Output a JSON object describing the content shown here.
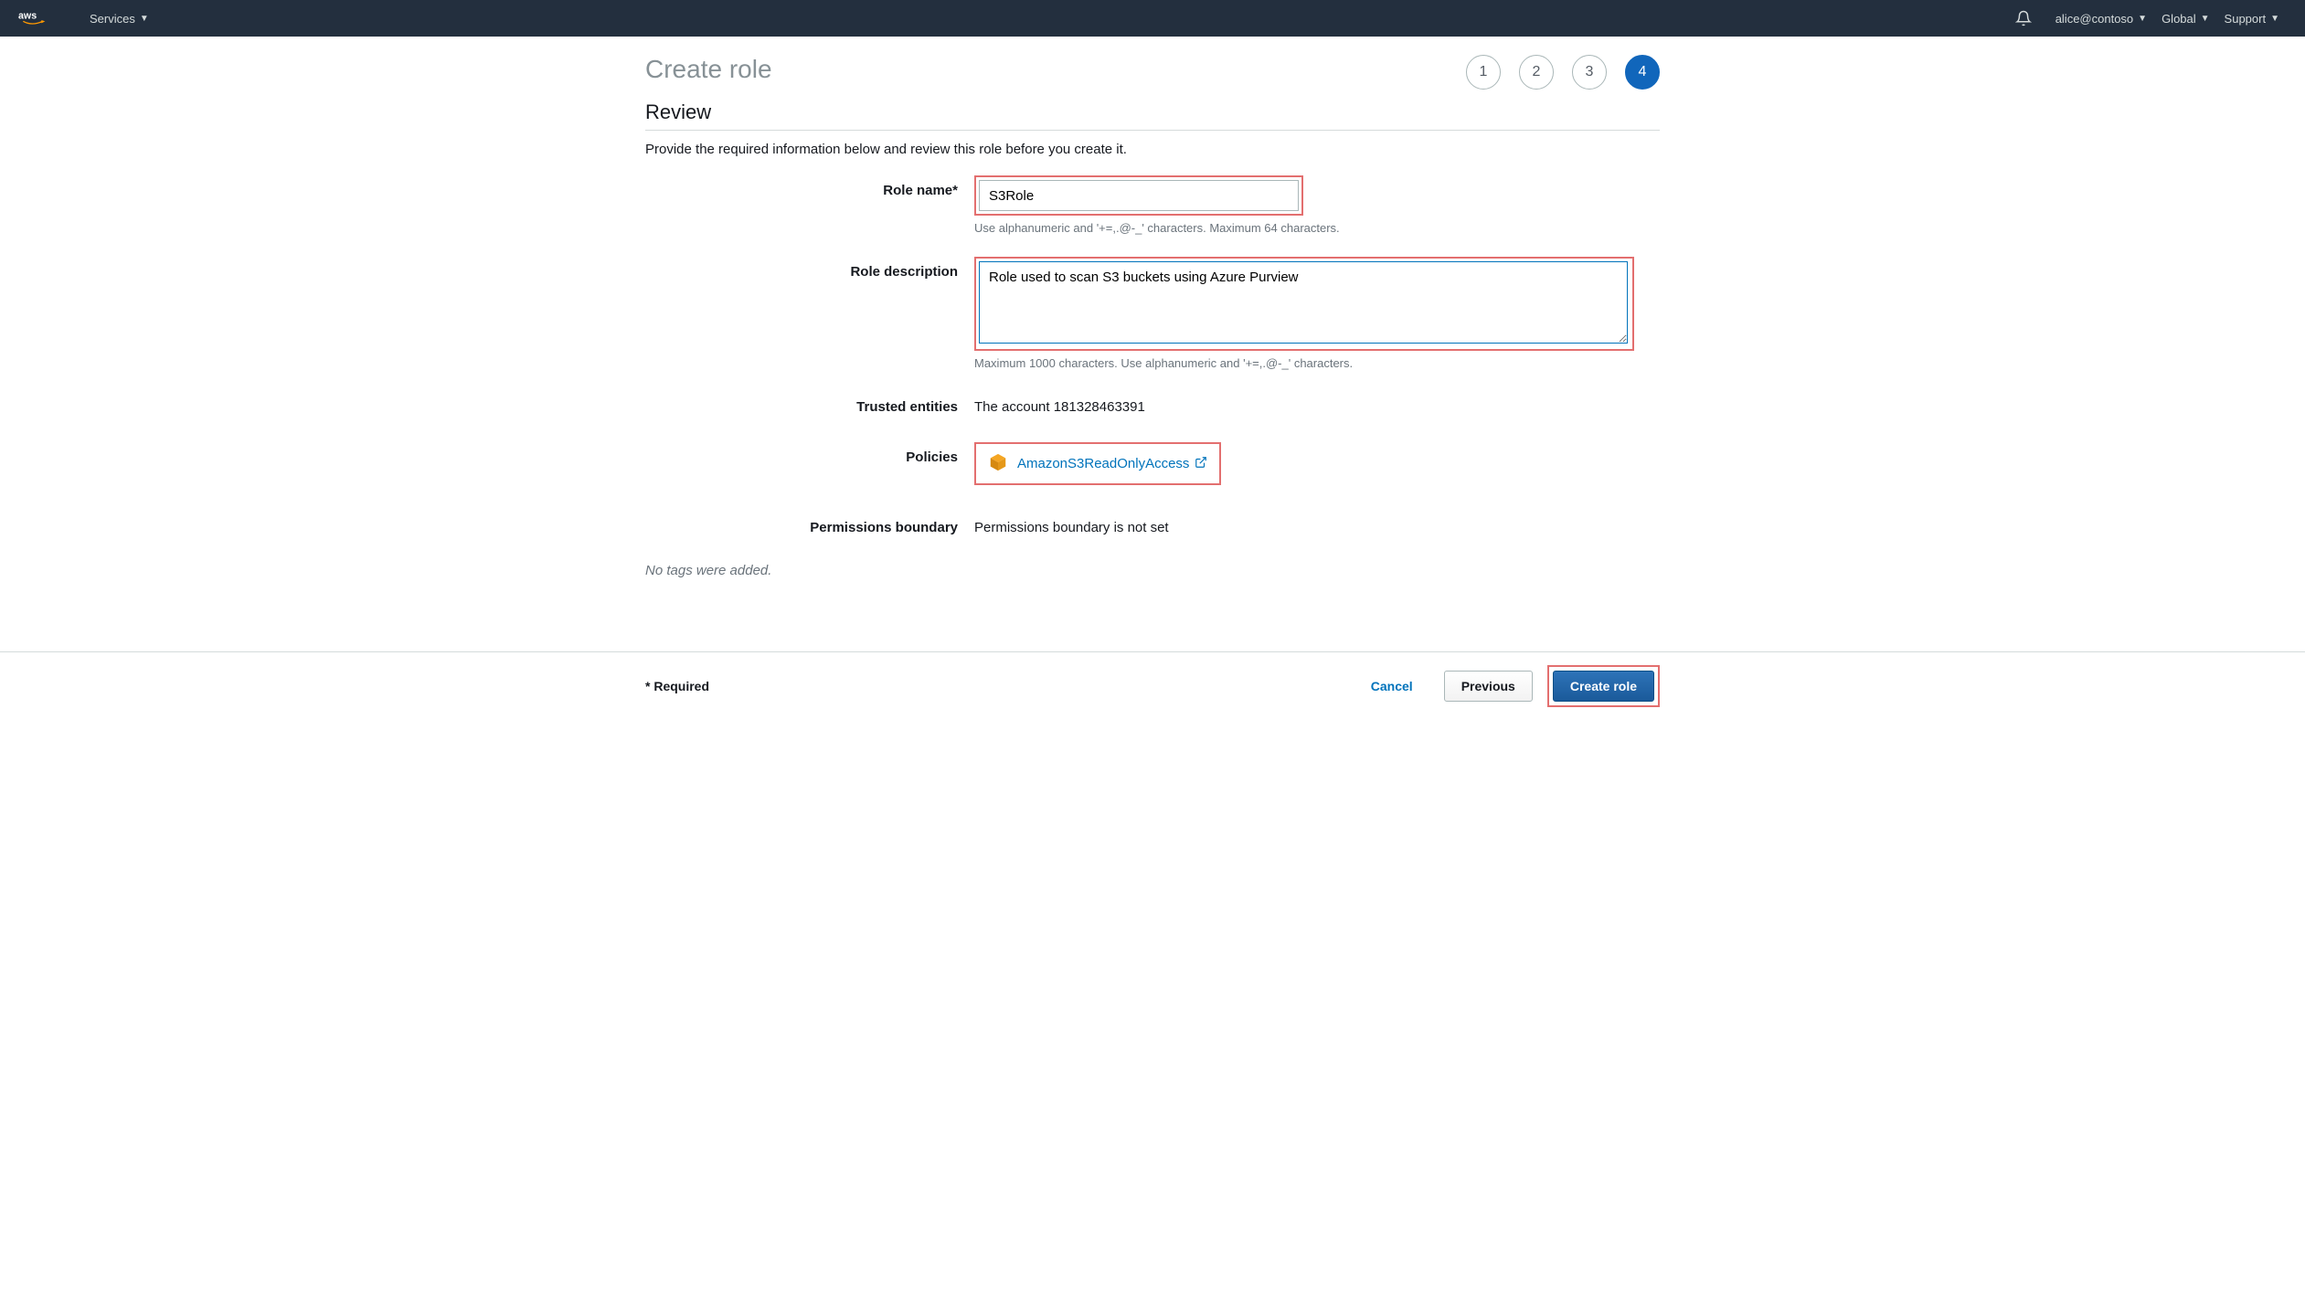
{
  "nav": {
    "services": "Services",
    "user": "alice@contoso",
    "region": "Global",
    "support": "Support"
  },
  "wizard": {
    "title": "Create role",
    "steps": [
      "1",
      "2",
      "3",
      "4"
    ],
    "active_step": "4",
    "section": "Review",
    "subtitle": "Provide the required information below and review this role before you create it."
  },
  "form": {
    "role_name": {
      "label": "Role name*",
      "value": "S3Role",
      "hint": "Use alphanumeric and '+=,.@-_' characters. Maximum 64 characters."
    },
    "role_description": {
      "label": "Role description",
      "value": "Role used to scan S3 buckets using Azure Purview",
      "hint": "Maximum 1000 characters. Use alphanumeric and '+=,.@-_' characters."
    },
    "trusted_entities": {
      "label": "Trusted entities",
      "value": "The account 181328463391"
    },
    "policies": {
      "label": "Policies",
      "items": [
        "AmazonS3ReadOnlyAccess"
      ]
    },
    "permissions_boundary": {
      "label": "Permissions boundary",
      "value": "Permissions boundary is not set"
    },
    "no_tags": "No tags were added."
  },
  "footer": {
    "required": "* Required",
    "cancel": "Cancel",
    "previous": "Previous",
    "create": "Create role"
  }
}
